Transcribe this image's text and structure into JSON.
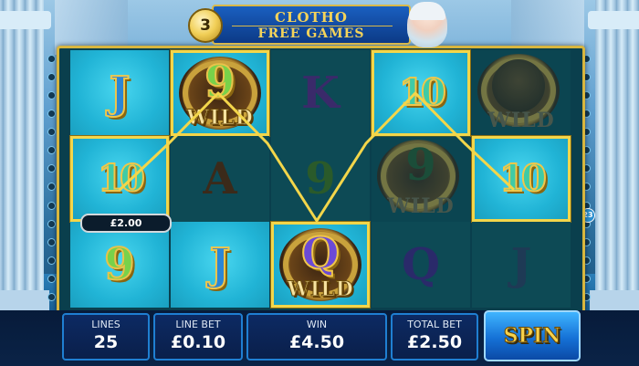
{
  "header": {
    "line1": "CLOTHO",
    "line2": "FREE GAMES",
    "free_games_remaining": "3"
  },
  "reels": [
    [
      {
        "symbol": "J",
        "style": "j-blue",
        "bg": "teal",
        "highlight": false
      },
      {
        "symbol": "10",
        "style": "ten",
        "bg": "teal",
        "highlight": true
      },
      {
        "symbol": "9",
        "style": "nine",
        "bg": "teal",
        "highlight": false
      }
    ],
    [
      {
        "symbol": "WILD",
        "inner": "9",
        "style": "nine",
        "bg": "teal",
        "highlight": true
      },
      {
        "symbol": "A",
        "style": "a-dark",
        "bg": "dark",
        "highlight": false
      },
      {
        "symbol": "J",
        "style": "j-blue",
        "bg": "teal",
        "highlight": false
      }
    ],
    [
      {
        "symbol": "K",
        "style": "k-dark",
        "bg": "dark",
        "highlight": false
      },
      {
        "symbol": "9",
        "style": "nine-dark",
        "bg": "dark",
        "highlight": false
      },
      {
        "symbol": "WILD",
        "inner": "Q",
        "style": "q",
        "bg": "teal",
        "highlight": true
      }
    ],
    [
      {
        "symbol": "10",
        "style": "ten",
        "bg": "teal",
        "highlight": true
      },
      {
        "symbol": "WILD",
        "inner": "9",
        "style": "nine-dark",
        "bg": "dark",
        "highlight": false,
        "dim": true
      },
      {
        "symbol": "Q",
        "style": "q-dark",
        "bg": "dark",
        "highlight": false
      }
    ],
    [
      {
        "symbol": "WILD",
        "inner": "face",
        "style": "dark",
        "bg": "dark",
        "highlight": false,
        "dim": true
      },
      {
        "symbol": "10",
        "style": "ten",
        "bg": "teal",
        "highlight": true
      },
      {
        "symbol": "J",
        "style": "j-dark",
        "bg": "dark",
        "highlight": false
      }
    ]
  ],
  "win_line_amount": "£2.00",
  "panel": {
    "lines_label": "LINES",
    "lines_value": "25",
    "line_bet_label": "LINE BET",
    "line_bet_value": "£0.10",
    "win_label": "WIN",
    "win_value": "£4.50",
    "total_bet_label": "TOTAL BET",
    "total_bet_value": "£2.50",
    "spin_label": "SPIN"
  },
  "side_line_number": "23",
  "colors": {
    "frame_gold": "#d8b63e",
    "win_line": "#f3d64a",
    "panel_blue": "#1f7fd2",
    "spin_text": "#f7d24c"
  }
}
